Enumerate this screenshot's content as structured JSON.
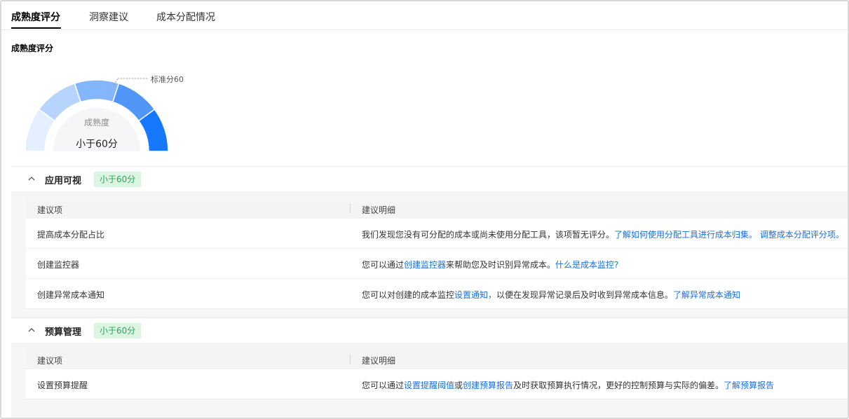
{
  "tabs": [
    {
      "label": "成熟度评分",
      "active": true
    },
    {
      "label": "洞察建议",
      "active": false
    },
    {
      "label": "成本分配情况",
      "active": false
    }
  ],
  "section_title": "成熟度评分",
  "gauge": {
    "label": "成熟度",
    "value": "小于60分",
    "standard_label": "标准分60",
    "segment_colors": [
      "#e3efff",
      "#b7d5fc",
      "#83b6fa",
      "#4f96f5",
      "#1677ff"
    ]
  },
  "groups": [
    {
      "title": "应用可视",
      "badge": "小于60分",
      "col_item": "建议项",
      "col_detail": "建议明细",
      "rows": [
        {
          "item": "提高成本分配占比",
          "detail": [
            {
              "text": "我们发现您没有可分配的成本或尚未使用分配工具，该项暂无评分。"
            },
            {
              "text": "了解如何使用分配工具进行成本归集。",
              "link": true
            },
            {
              "text": " "
            },
            {
              "text": "调整成本分配评分项。",
              "link": true
            }
          ]
        },
        {
          "item": "创建监控器",
          "detail": [
            {
              "text": "您可以通过"
            },
            {
              "text": "创建监控器",
              "link": true
            },
            {
              "text": "来帮助您及时识别异常成本。"
            },
            {
              "text": "什么是成本监控?",
              "link": true
            }
          ]
        },
        {
          "item": "创建异常成本通知",
          "detail": [
            {
              "text": "您可以对创建的成本监控"
            },
            {
              "text": "设置通知，",
              "link": true
            },
            {
              "text": "以便在发现异常记录后及时收到异常成本信息。"
            },
            {
              "text": "了解异常成本通知",
              "link": true
            }
          ]
        }
      ]
    },
    {
      "title": "预算管理",
      "badge": "小于60分",
      "col_item": "建议项",
      "col_detail": "建议明细",
      "rows": [
        {
          "item": "设置预算提醒",
          "detail": [
            {
              "text": "您可以通过"
            },
            {
              "text": "设置提醒阈值",
              "link": true
            },
            {
              "text": "或"
            },
            {
              "text": "创建预算报告",
              "link": true
            },
            {
              "text": "及时获取预算执行情况，更好的控制预算与实际的偏差。"
            },
            {
              "text": "了解预算报告",
              "link": true
            }
          ]
        }
      ]
    }
  ],
  "colors": {
    "link": "#1a6fdd",
    "badge_text": "#2ba55a",
    "badge_bg": "#dcf5e3"
  }
}
